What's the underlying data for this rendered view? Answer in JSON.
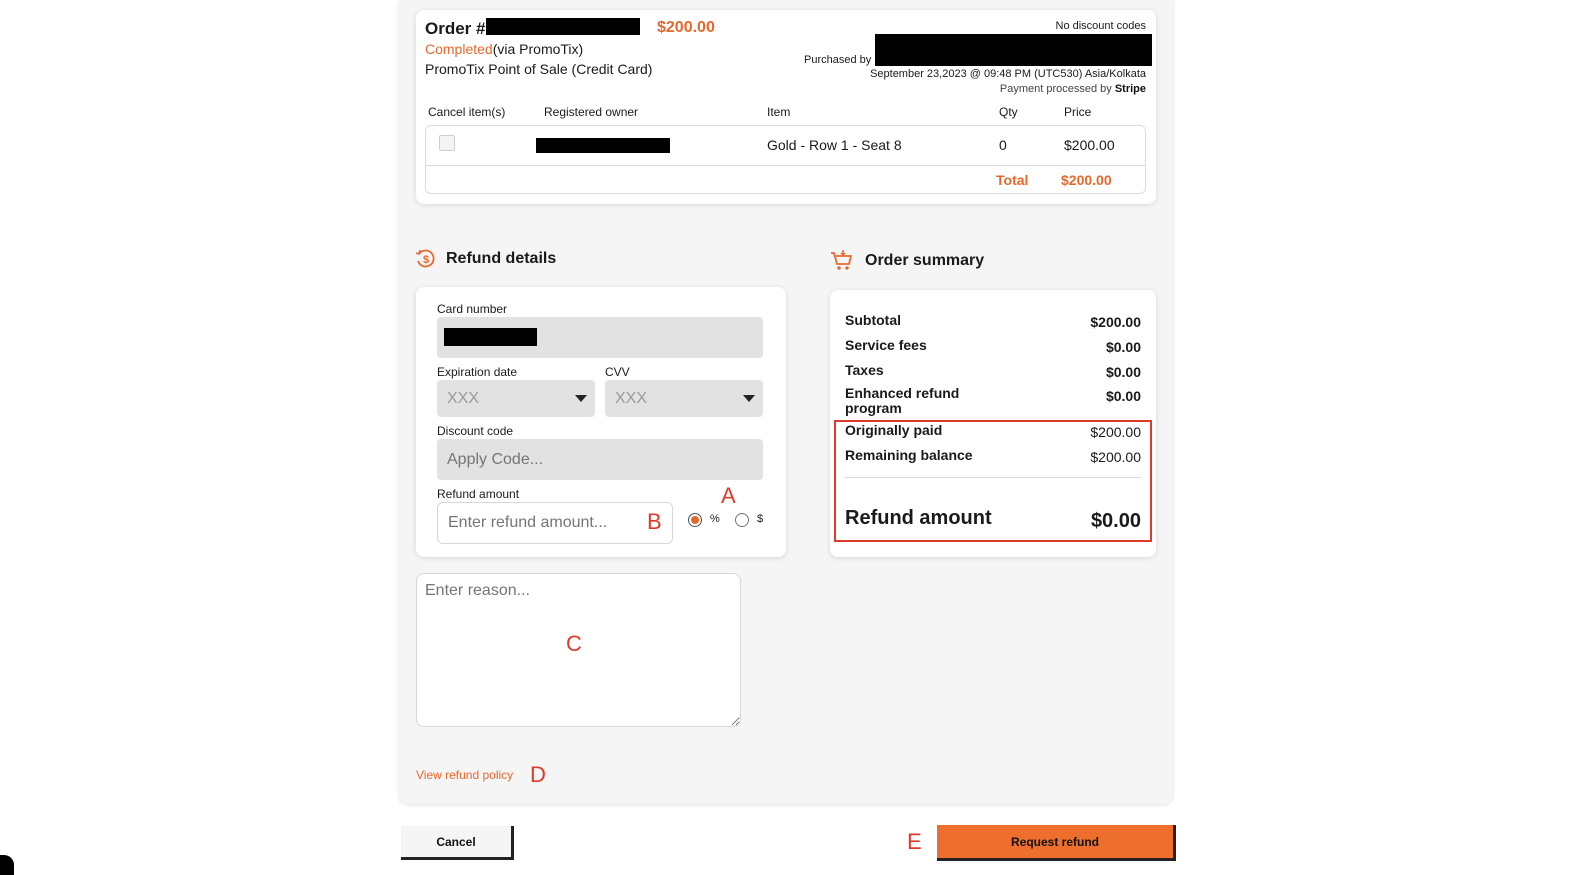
{
  "order": {
    "title_prefix": "Order #",
    "amount": "$200.00",
    "status": "Completed",
    "via": "(via PromoTix)",
    "pos": "PromoTix Point of Sale (Credit Card)",
    "no_discount": "No discount codes",
    "purchased_by_label": "Purchased by",
    "datetime": "September 23,2023 @ 09:48 PM (UTC530) Asia/Kolkata",
    "processed_prefix": "Payment processed by ",
    "processor": "Stripe"
  },
  "items_table": {
    "headers": [
      "Cancel item(s)",
      "Registered owner",
      "Item",
      "Qty",
      "Price"
    ],
    "rows": [
      {
        "item": "Gold - Row 1 - Seat 8",
        "qty": "0",
        "price": "$200.00"
      }
    ],
    "total_label": "Total",
    "total_value": "$200.00"
  },
  "refund_details": {
    "heading": "Refund details",
    "card_number_label": "Card number",
    "expiration_label": "Expiration date",
    "expiration_value": "XXX",
    "cvv_label": "CVV",
    "cvv_value": "XXX",
    "discount_label": "Discount code",
    "discount_placeholder": "Apply Code...",
    "refund_amount_label": "Refund amount",
    "refund_amount_placeholder": "Enter refund amount...",
    "percent_label": "%",
    "dollar_label": "$",
    "selected_mode": "%"
  },
  "reason": {
    "placeholder": "Enter reason..."
  },
  "order_summary": {
    "heading": "Order summary",
    "subtotal_label": "Subtotal",
    "subtotal_value": "$200.00",
    "service_fees_label": "Service fees",
    "service_fees_value": "$0.00",
    "taxes_label": "Taxes",
    "taxes_value": "$0.00",
    "enhanced_label": "Enhanced refund program",
    "enhanced_value": "$0.00",
    "originally_paid_label": "Originally paid",
    "originally_paid_value": "$200.00",
    "remaining_label": "Remaining balance",
    "remaining_value": "$200.00",
    "refund_amount_label": "Refund amount",
    "refund_amount_value": "$0.00"
  },
  "links": {
    "refund_policy": "View refund policy"
  },
  "buttons": {
    "cancel": "Cancel",
    "request_refund": "Request refund"
  },
  "annotations": {
    "a": "A",
    "b": "B",
    "c": "C",
    "d": "D",
    "e": "E"
  },
  "colors": {
    "accent": "#e8682c",
    "highlight_box": "#e03a2a"
  }
}
